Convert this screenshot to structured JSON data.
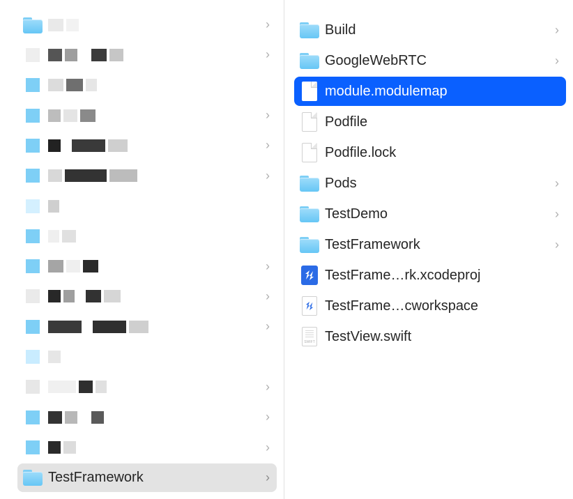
{
  "left_column": {
    "shown_item": {
      "label": "TestFramework"
    },
    "obscured_count": 14
  },
  "right_column": {
    "items": [
      {
        "label": "Build",
        "kind": "folder",
        "has_children": true,
        "selected": false
      },
      {
        "label": "GoogleWebRTC",
        "kind": "folder",
        "has_children": true,
        "selected": false
      },
      {
        "label": "module.modulemap",
        "kind": "file",
        "has_children": false,
        "selected": true
      },
      {
        "label": "Podfile",
        "kind": "file",
        "has_children": false,
        "selected": false
      },
      {
        "label": "Podfile.lock",
        "kind": "file",
        "has_children": false,
        "selected": false
      },
      {
        "label": "Pods",
        "kind": "folder",
        "has_children": true,
        "selected": false
      },
      {
        "label": "TestDemo",
        "kind": "folder",
        "has_children": true,
        "selected": false
      },
      {
        "label": "TestFramework",
        "kind": "folder",
        "has_children": true,
        "selected": false
      },
      {
        "label": "TestFrame…rk.xcodeproj",
        "kind": "xcodeproj",
        "has_children": false,
        "selected": false
      },
      {
        "label": "TestFrame…cworkspace",
        "kind": "xcworkspace",
        "has_children": false,
        "selected": false
      },
      {
        "label": "TestView.swift",
        "kind": "swift",
        "has_children": false,
        "selected": false
      }
    ]
  }
}
